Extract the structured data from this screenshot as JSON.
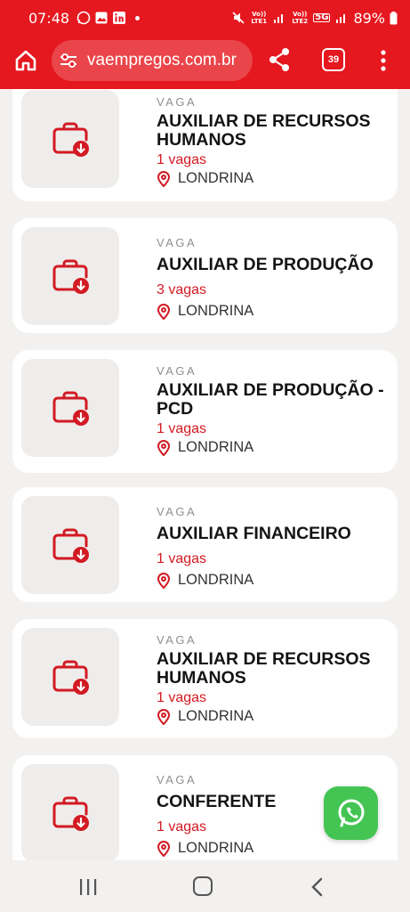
{
  "status_bar": {
    "time": "07:48",
    "network_1": "Vo)) LTE1",
    "network_2": "Vo)) LTE2",
    "network_5g": "5G",
    "battery": "89%"
  },
  "browser": {
    "url": "vaempregos.com.br",
    "tab_count": "39"
  },
  "listings": [
    {
      "kicker": "VAGA",
      "title": "AUXILIAR DE RECURSOS HUMANOS",
      "count": "1 vagas",
      "location": "LONDRINA"
    },
    {
      "kicker": "VAGA",
      "title": "AUXILIAR DE PRODUÇÃO",
      "count": "3 vagas",
      "location": "LONDRINA"
    },
    {
      "kicker": "VAGA",
      "title": "AUXILIAR DE PRODUÇÃO - PCD",
      "count": "1 vagas",
      "location": "LONDRINA"
    },
    {
      "kicker": "VAGA",
      "title": "AUXILIAR FINANCEIRO",
      "count": "1 vagas",
      "location": "LONDRINA"
    },
    {
      "kicker": "VAGA",
      "title": "AUXILIAR DE RECURSOS HUMANOS",
      "count": "1 vagas",
      "location": "LONDRINA"
    },
    {
      "kicker": "VAGA",
      "title": "CONFERENTE",
      "count": "1 vagas",
      "location": "LONDRINA"
    }
  ],
  "colors": {
    "brand_red": "#e5171f",
    "vagas_red": "#d21a23",
    "whatsapp_green": "#44c553"
  },
  "icons": [
    "home-icon",
    "site-settings-icon",
    "share-icon",
    "tabs-icon",
    "more-icon",
    "briefcase-icon",
    "location-pin-icon",
    "whatsapp-icon"
  ]
}
